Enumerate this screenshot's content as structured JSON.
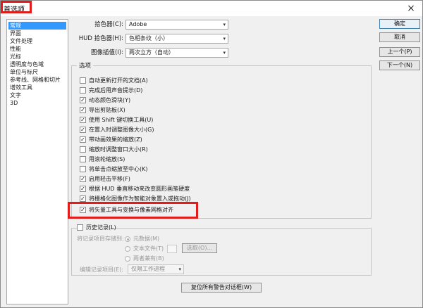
{
  "window": {
    "title": "首选项",
    "close_glyph": "×"
  },
  "sidebar": {
    "items": [
      {
        "label": "常规",
        "selected": true
      },
      {
        "label": "界面"
      },
      {
        "label": "文件处理"
      },
      {
        "label": "性能"
      },
      {
        "label": "光标"
      },
      {
        "label": "透明度与色域"
      },
      {
        "label": "单位与标尺"
      },
      {
        "label": "参考线、网格和切片"
      },
      {
        "label": "增效工具"
      },
      {
        "label": "文字"
      },
      {
        "label": "3D"
      }
    ]
  },
  "form": {
    "color_picker": {
      "label": "拾色器(C):",
      "value": "Adobe"
    },
    "hud_picker": {
      "label": "HUD 拾色器(H):",
      "value": "色相条纹（小）"
    },
    "interpolation": {
      "label": "图像插值(I):",
      "value": "两次立方（自动）"
    }
  },
  "options": {
    "title": "选项",
    "items": [
      {
        "label": "自动更新打开的文档(A)",
        "checked": false
      },
      {
        "label": "完成后用声音提示(D)",
        "checked": false
      },
      {
        "label": "动态颜色滑块(Y)",
        "checked": true
      },
      {
        "label": "导出剪贴板(X)",
        "checked": true
      },
      {
        "label": "使用 Shift 键切换工具(U)",
        "checked": true
      },
      {
        "label": "在置入时调整图像大小(G)",
        "checked": true
      },
      {
        "label": "带动画效果的缩放(Z)",
        "checked": true
      },
      {
        "label": "缩放时调整窗口大小(R)",
        "checked": false
      },
      {
        "label": "用滚轮缩放(S)",
        "checked": false
      },
      {
        "label": "将单击点缩放至中心(K)",
        "checked": false
      },
      {
        "label": "启用轻击平移(F)",
        "checked": true
      },
      {
        "label": "根据 HUD 垂直移动来改变圆形画笔硬度",
        "checked": true
      },
      {
        "label": "将栅格化图像作为智能对象置入或拖动(J)",
        "checked": true
      },
      {
        "label": "将矢量工具与变换与像素网格对齐",
        "checked": true
      }
    ]
  },
  "history": {
    "title": "历史记录(L)",
    "checked": false,
    "save_to_label": "将记录项目存储到:",
    "radios": [
      {
        "label": "元数据(M)",
        "selected": true
      },
      {
        "label": "文本文件(T)",
        "selected": false
      },
      {
        "label": "两者兼有(B)",
        "selected": false
      }
    ],
    "choose_button": "选取(O)...",
    "edit_log_label": "编辑记录项目(E):",
    "edit_log_value": "仅限工作进程"
  },
  "buttons": {
    "ok": "确定",
    "cancel": "取消",
    "prev": "上一个(P)",
    "next": "下一个(N)",
    "reset_warnings": "复位所有警告对话框(W)"
  },
  "icons": {
    "dropdown": "▾",
    "check": "✓"
  },
  "colors": {
    "selection": "#3399ff",
    "annotation": "#e21b1b"
  }
}
